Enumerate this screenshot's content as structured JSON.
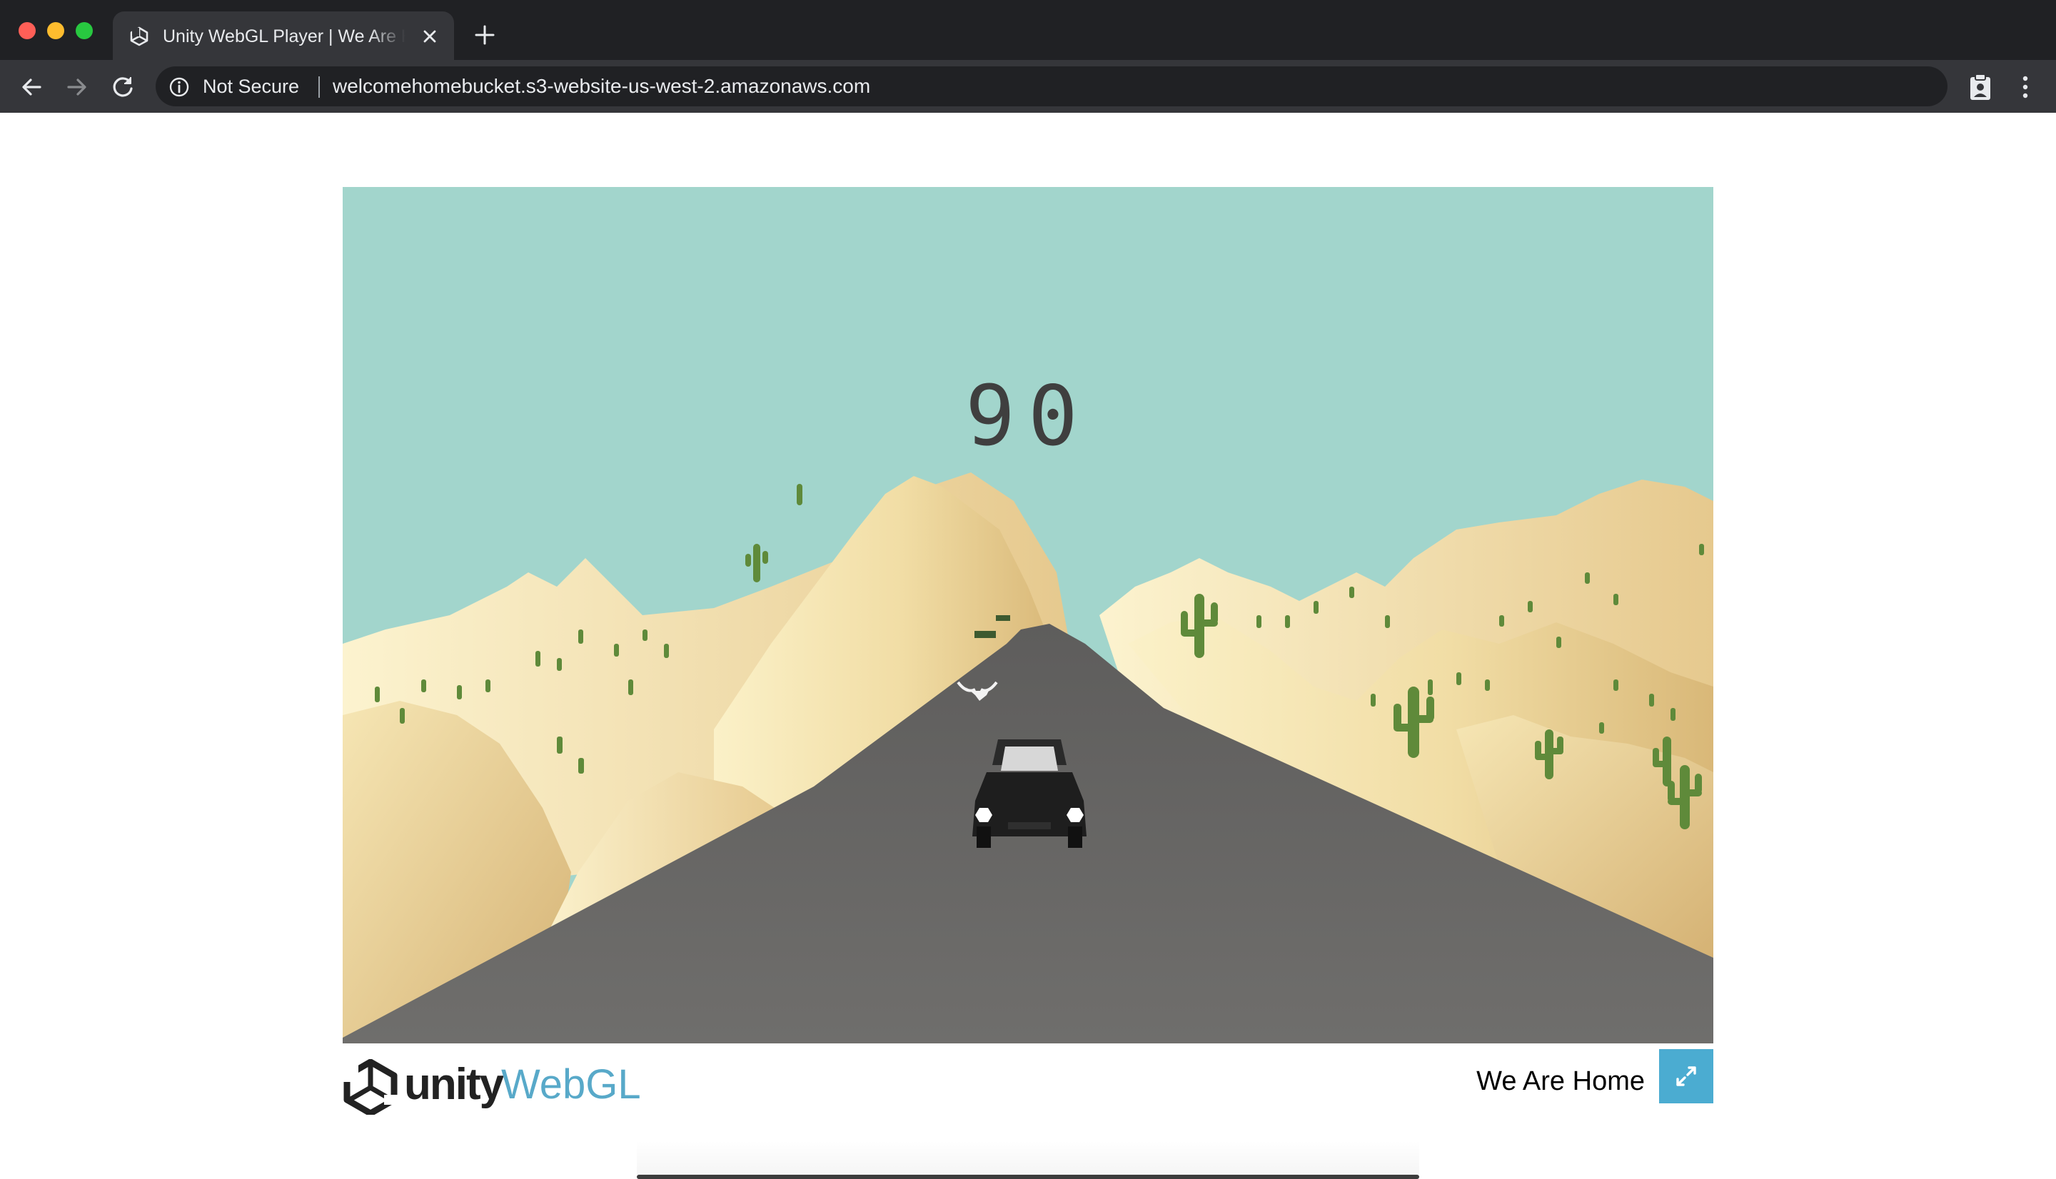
{
  "browser": {
    "tab_title": "Unity WebGL Player | We Are Home",
    "security_label": "Not Secure",
    "url": "welcomehomebucket.s3-website-us-west-2.amazonaws.com",
    "icons": [
      "unity-favicon-icon",
      "close-icon",
      "plus-icon",
      "back-arrow-icon",
      "forward-arrow-icon",
      "reload-icon",
      "info-icon",
      "extension-clipboard-icon",
      "kebab-menu-icon"
    ]
  },
  "game": {
    "score": "90",
    "sky_color": "#a2d5cc",
    "sand_color": "#f3e2ad",
    "road_color": "#6d6c6a",
    "car_color": "#1e1e1e",
    "cactus_color": "#5f8a3a"
  },
  "footer": {
    "brand_unity": "unity",
    "brand_webgl": "WebGL",
    "title": "We Are Home",
    "accent_color": "#4bacd1",
    "fullscreen_icon": "fullscreen-expand-icon"
  }
}
